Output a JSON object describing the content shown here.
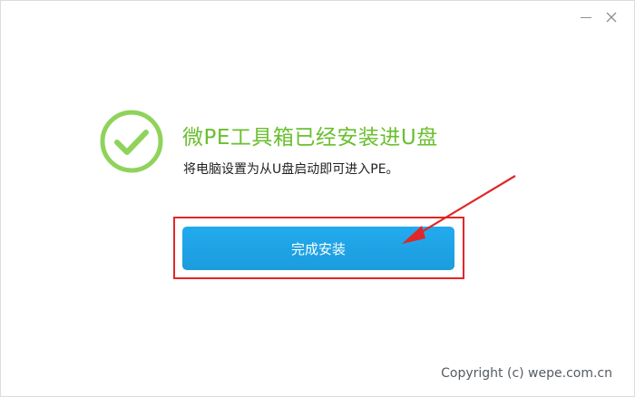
{
  "window": {
    "minimize_label": "Minimize",
    "close_label": "Close"
  },
  "result": {
    "title": "微PE工具箱已经安装进U盘",
    "subtitle": "将电脑设置为从U盘启动即可进入PE。",
    "status_icon": "check-circle-icon"
  },
  "actions": {
    "finish_label": "完成安装"
  },
  "footer": {
    "copyright": "Copyright (c) wepe.com.cn"
  },
  "colors": {
    "success_green": "#6abf2f",
    "button_blue": "#1ea3e6",
    "annotation_red": "#e12727"
  }
}
